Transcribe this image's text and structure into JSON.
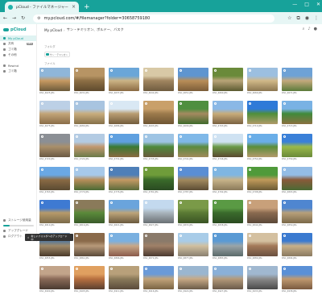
{
  "browser": {
    "tab_title": "pCloud - ファイルマネージャー",
    "url": "my.pcloud.com/#/filemanager?folder=30658759180"
  },
  "sidebar": {
    "brand": "pCloud",
    "items": [
      {
        "label": "My pCloud",
        "active": true
      },
      {
        "label": "共有",
        "badge": "NEW"
      },
      {
        "label": "ゴミ箱"
      },
      {
        "label": "その他"
      },
      {
        "label": "Rewind"
      },
      {
        "label": "ゴミ箱"
      }
    ],
    "footer": [
      {
        "label": "ストレージ使用量"
      },
      {
        "label": "アップグレード"
      },
      {
        "label": "ログアウト"
      }
    ],
    "storage_used_fraction": 0.2
  },
  "main": {
    "breadcrumb": [
      "My pCloud",
      "サン・テミリオン、ボルドー、バスク"
    ],
    "section_folders": "フォルダ",
    "folder_name": "サン・テミリオン",
    "section_files": "ファイル"
  },
  "photos": [
    {
      "name": "DSC_4625.JPG",
      "colors": [
        "#8fb6d9",
        "#c79a62",
        "#6b5a3a"
      ]
    },
    {
      "name": "DSC_4631.JPG",
      "colors": [
        "#b79464",
        "#8d6f45",
        "#5e4a2d"
      ]
    },
    {
      "name": "DSC_4637.JPG",
      "colors": [
        "#6aa6d8",
        "#ccb485",
        "#8a6a42"
      ]
    },
    {
      "name": "DSC_4642.JPG",
      "colors": [
        "#d8c9a6",
        "#a18660",
        "#6e5b3f"
      ]
    },
    {
      "name": "DSC_4651.JPG",
      "colors": [
        "#5f95d0",
        "#b98e58",
        "#7b5c38"
      ]
    },
    {
      "name": "DSC_4660.JPG",
      "colors": [
        "#6a8a3a",
        "#b9a478",
        "#5a5a30"
      ]
    },
    {
      "name": "DSC_4669.JPG",
      "colors": [
        "#9cbfe0",
        "#d1b988",
        "#8b7650"
      ]
    },
    {
      "name": "DSC_4671.JPG",
      "colors": [
        "#6ea2d6",
        "#c4a97c",
        "#5a7a3a"
      ]
    },
    {
      "name": "DSC_4675.JPG",
      "colors": [
        "#bcd0e6",
        "#c2a478",
        "#8a6d48"
      ]
    },
    {
      "name": "DSC_4680.JPG",
      "colors": [
        "#a8c4e0",
        "#c9ad7d",
        "#857049"
      ]
    },
    {
      "name": "DSC_4686.JPG",
      "colors": [
        "#d9e8f4",
        "#b99d72",
        "#735d3d"
      ]
    },
    {
      "name": "DSC_4693.JPG",
      "colors": [
        "#c9a06a",
        "#9c7a4c",
        "#6e5533"
      ]
    },
    {
      "name": "DSC_4699.JPG",
      "colors": [
        "#4f8f3f",
        "#a58a60",
        "#3f6a2c"
      ]
    },
    {
      "name": "DSC_4703.JPG",
      "colors": [
        "#8ab8e6",
        "#c8ac7a",
        "#7a6242"
      ]
    },
    {
      "name": "DSC_4710.JPG",
      "colors": [
        "#2f7ad8",
        "#4f8f3a",
        "#b09a6a"
      ]
    },
    {
      "name": "DSC_4715.JPG",
      "colors": [
        "#79b2e4",
        "#3f8a3a",
        "#8a7040"
      ]
    },
    {
      "name": "DSC_4720.JPG",
      "colors": [
        "#8b8f95",
        "#a98f6a",
        "#6b5a44"
      ]
    },
    {
      "name": "DSC_4724.JPG",
      "colors": [
        "#b3cbe3",
        "#c29870",
        "#6a7a48"
      ]
    },
    {
      "name": "DSC_4731.JPG",
      "colors": [
        "#5fa0e0",
        "#3a7a34",
        "#8a6a40"
      ]
    },
    {
      "name": "DSC_4735.JPG",
      "colors": [
        "#9ec4e4",
        "#4f8a3c",
        "#6a5a3c"
      ]
    },
    {
      "name": "DSC_4741.JPG",
      "colors": [
        "#7fb8e8",
        "#5a8a40",
        "#a08a5a"
      ]
    },
    {
      "name": "DSC_4746.JPG",
      "colors": [
        "#cfe2f2",
        "#6a9a48",
        "#5a4a30"
      ]
    },
    {
      "name": "DSC_4752.JPG",
      "colors": [
        "#6aaee8",
        "#5a8e3a",
        "#b49a6c"
      ]
    },
    {
      "name": "DSC_4759.JPG",
      "colors": [
        "#3a80d8",
        "#9ab94a",
        "#6a8a3a"
      ]
    },
    {
      "name": "DSC_4763.JPG",
      "colors": [
        "#6aa8e4",
        "#8a6a44",
        "#5a4a32"
      ]
    },
    {
      "name": "DSC_4770.JPG",
      "colors": [
        "#a7c9ea",
        "#b88e5a",
        "#4a6a34"
      ]
    },
    {
      "name": "DSC_4776.JPG",
      "colors": [
        "#4e7fb8",
        "#c49a64",
        "#5a6a3a"
      ]
    },
    {
      "name": "DSC_4781.JPG",
      "colors": [
        "#6f9c3a",
        "#3a6a2a",
        "#2a4a22"
      ]
    },
    {
      "name": "DSC_4787.JPG",
      "colors": [
        "#5a8ed4",
        "#a28a5e",
        "#5c4c34"
      ]
    },
    {
      "name": "DSC_4792.JPG",
      "colors": [
        "#7fb6e2",
        "#c8b48a",
        "#8a7a5a"
      ]
    },
    {
      "name": "DSC_4798.JPG",
      "colors": [
        "#4f9a3a",
        "#c09a5a",
        "#6a5a34"
      ]
    },
    {
      "name": "DSC_4803.JPG",
      "colors": [
        "#94bde6",
        "#8a5a3a",
        "#4a6a34"
      ]
    },
    {
      "name": "DSC_4810.JPG",
      "colors": [
        "#3e7ad2",
        "#b79a6a",
        "#7a6a4a"
      ]
    },
    {
      "name": "DSC_4816.JPG",
      "colors": [
        "#8a7a5a",
        "#5a8a3a",
        "#3a5a2a"
      ]
    },
    {
      "name": "DSC_4821.JPG",
      "colors": [
        "#6aa4dc",
        "#bda47a",
        "#6a5a3e"
      ]
    },
    {
      "name": "DSC_4827.JPG",
      "colors": [
        "#c3d9ee",
        "#a9b4bc",
        "#6a7074"
      ]
    },
    {
      "name": "DSC_4833.JPG",
      "colors": [
        "#7a9a48",
        "#5a7a34",
        "#3a5424"
      ]
    },
    {
      "name": "DSC_4838.JPG",
      "colors": [
        "#5a9a44",
        "#3a6a2c",
        "#2a4a20"
      ]
    },
    {
      "name": "DSC_4844.JPG",
      "colors": [
        "#c8a07a",
        "#8a6a50",
        "#5a4838"
      ]
    },
    {
      "name": "DSC_4850.JPG",
      "colors": [
        "#4f86d0",
        "#b8a07a",
        "#7a6848"
      ]
    },
    {
      "name": "DSC_4855.JPG",
      "colors": [
        "#5a7a9a",
        "#a08a6a",
        "#4a3a2a"
      ]
    },
    {
      "name": "DSC_4861.JPG",
      "colors": [
        "#8a6a4a",
        "#b89a7a",
        "#5a4a3a"
      ]
    },
    {
      "name": "DSC_4866.JPG",
      "colors": [
        "#7ab0e0",
        "#c8a888",
        "#8a5a4a"
      ]
    },
    {
      "name": "DSC_4872.JPG",
      "colors": [
        "#8a7a6a",
        "#a08068",
        "#4a3a30"
      ]
    },
    {
      "name": "DSC_4877.JPG",
      "colors": [
        "#a8cce8",
        "#d0c0a0",
        "#8a8070"
      ]
    },
    {
      "name": "DSC_4883.JPG",
      "colors": [
        "#5a9ad4",
        "#9aa4a8",
        "#5a6a6a"
      ]
    },
    {
      "name": "DSC_4889.JPG",
      "colors": [
        "#d4c0a0",
        "#a47a5a",
        "#6a5040"
      ]
    },
    {
      "name": "DSC_4894.JPG",
      "colors": [
        "#3a7ad0",
        "#c8b08a",
        "#8a7a60"
      ]
    },
    {
      "name": "DSC_4900.JPG",
      "colors": [
        "#c2a48a",
        "#8a6a58",
        "#4a3a30"
      ]
    },
    {
      "name": "DSC_4905.JPG",
      "colors": [
        "#e0a060",
        "#b87040",
        "#5a4030"
      ]
    },
    {
      "name": "DSC_4911.JPG",
      "colors": [
        "#b8a07a",
        "#8a7a5a",
        "#5a4a3a"
      ]
    },
    {
      "name": "DSC_4916.JPG",
      "colors": [
        "#6a9ad8",
        "#c2a47a",
        "#7a6444"
      ]
    },
    {
      "name": "DSC_4922.JPG",
      "colors": [
        "#9ab6d0",
        "#c8aa86",
        "#6a5a48"
      ]
    },
    {
      "name": "DSC_4927.JPG",
      "colors": [
        "#8ab0d8",
        "#b49a7a",
        "#6a5a4a"
      ]
    },
    {
      "name": "DSC_4933.JPG",
      "colors": [
        "#a0b8d0",
        "#8a8a8a",
        "#4a4a4a"
      ]
    },
    {
      "name": "DSC_4938.JPG",
      "colors": [
        "#5a90d6",
        "#c09a70",
        "#7a5a40"
      ]
    }
  ],
  "toast": {
    "text": "新しいフォルダへのアップロード中"
  },
  "upload_progress_fraction": 0.3
}
